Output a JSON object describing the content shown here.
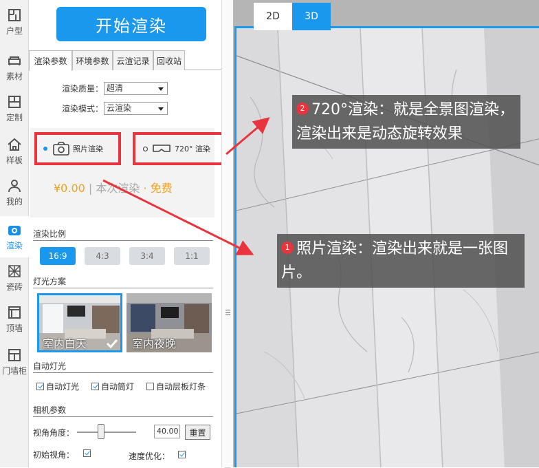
{
  "sidebar": {
    "items": [
      {
        "label": "户型",
        "icon": "floorplan-icon"
      },
      {
        "label": "素材",
        "icon": "sofa-icon"
      },
      {
        "label": "定制",
        "icon": "cabinet-icon"
      },
      {
        "label": "样板",
        "icon": "house-icon"
      },
      {
        "label": "我的",
        "icon": "user-icon"
      },
      {
        "label": "渲染",
        "icon": "camera-icon",
        "active": true
      },
      {
        "label": "瓷砖",
        "icon": "tile-icon"
      },
      {
        "label": "顶墙",
        "icon": "ceiling-icon"
      },
      {
        "label": "门墙柜",
        "icon": "door-cabinet-icon"
      }
    ]
  },
  "panel": {
    "start_button": "开始渲染",
    "tabs": [
      "渲染参数",
      "环境参数",
      "云渲记录",
      "回收站"
    ],
    "quality_label": "渲染质量：",
    "quality_value": "超清",
    "mode_label": "渲染模式：",
    "mode_value": "云渲染",
    "photo_option": "照片渲染",
    "pano_option": "720° 渲染",
    "price": "¥0.00",
    "price_sep": "|",
    "price_desc": "本次渲染",
    "price_dot": "·",
    "price_free": "免费",
    "ratio_title": "渲染比例",
    "ratios": [
      "16:9",
      "4:3",
      "3:4",
      "1:1"
    ],
    "light_title": "灯光方案",
    "light_options": [
      "室内白天",
      "室内夜晚"
    ],
    "auto_light_title": "自动灯光",
    "auto_lights": [
      {
        "label": "自动灯光",
        "checked": true
      },
      {
        "label": "自动筒灯",
        "checked": true
      },
      {
        "label": "自动层板灯条",
        "checked": false
      }
    ],
    "camera_title": "相机参数",
    "fov_label": "视角角度：",
    "fov_value": "40.00",
    "reset_button": "重置",
    "init_view_label": "初始视角：",
    "speed_label": "速度优化："
  },
  "viewport": {
    "tabs": [
      "2D",
      "3D"
    ],
    "active_tab": "3D"
  },
  "annotations": [
    {
      "badge": "2",
      "text": "720°渲染：就是全景图渲染，渲染出来是动态旋转效果"
    },
    {
      "badge": "1",
      "text": "照片渲染：渲染出来就是一张图片。"
    }
  ],
  "colors": {
    "accent": "#1a98ee",
    "highlight_red": "#e8343c",
    "price": "#f0a020"
  }
}
